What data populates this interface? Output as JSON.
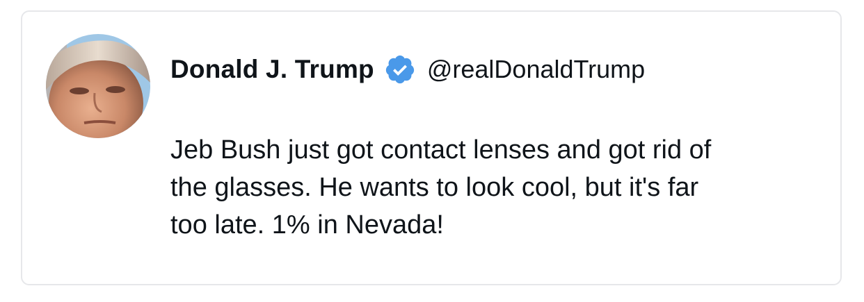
{
  "tweet": {
    "author": {
      "display_name": "Donald J. Trump",
      "handle": "@realDonaldTrump",
      "verified": true,
      "avatar_icon": "profile-photo"
    },
    "text": "Jeb Bush just got contact lenses and got rid of\nthe glasses. He wants to look cool, but it's far\ntoo late. 1% in Nevada!"
  },
  "colors": {
    "verified_badge": "#4a99e9",
    "text": "#0f1419",
    "border": "#e6e7ea"
  }
}
